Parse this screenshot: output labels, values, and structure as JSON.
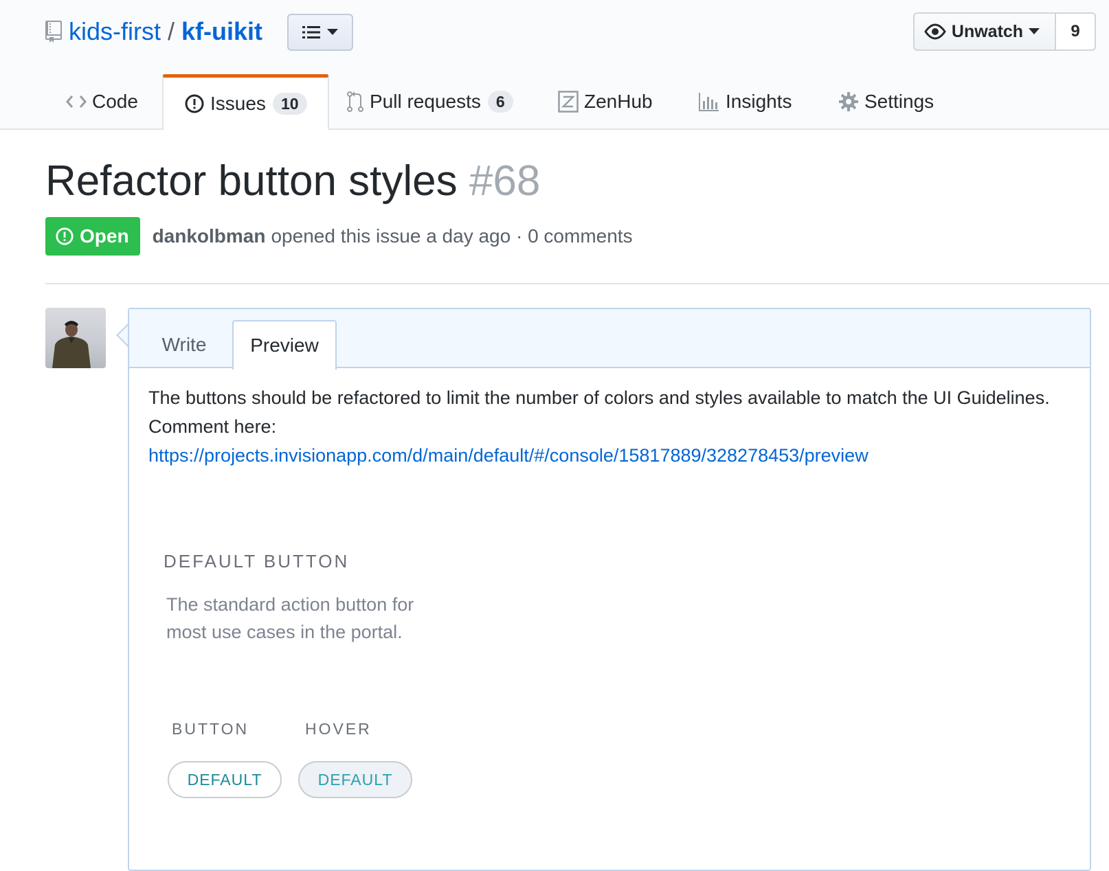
{
  "repo": {
    "owner": "kids-first",
    "divider": "/",
    "name": "kf-uikit"
  },
  "watch": {
    "label": "Unwatch",
    "count": "9"
  },
  "nav": {
    "tabs": [
      {
        "label": "Code",
        "icon": "code-icon"
      },
      {
        "label": "Issues",
        "icon": "issue-opened-icon",
        "counter": "10",
        "selected": true
      },
      {
        "label": "Pull requests",
        "icon": "git-pull-request-icon",
        "counter": "6"
      },
      {
        "label": "ZenHub",
        "icon": "zenhub-icon"
      },
      {
        "label": "Insights",
        "icon": "graph-icon"
      },
      {
        "label": "Settings",
        "icon": "gear-icon"
      }
    ]
  },
  "issue": {
    "title": "Refactor button styles",
    "number": "#68",
    "state": "Open",
    "author": "dankolbman",
    "meta": "opened this issue a day ago · 0 comments"
  },
  "comment": {
    "tabs": {
      "write": "Write",
      "preview": "Preview"
    },
    "text_line": "The buttons should be refactored to limit the number of colors and styles available to match the UI Guidelines.",
    "comment_label": "Comment here:",
    "link": "https://projects.invisionapp.com/d/main/default/#/console/15817889/328278453/preview",
    "preview": {
      "section_title": "DEFAULT BUTTON",
      "section_desc": "The standard action button for most use cases in the portal.",
      "col_button": "BUTTON",
      "col_hover": "HOVER",
      "button_label": "DEFAULT",
      "hover_label": "DEFAULT"
    }
  },
  "colors": {
    "link": "#0366d6",
    "open_badge": "#2cbe4e",
    "selected_tab_accent": "#e36209",
    "demo_button_text": "#1b8a99"
  }
}
